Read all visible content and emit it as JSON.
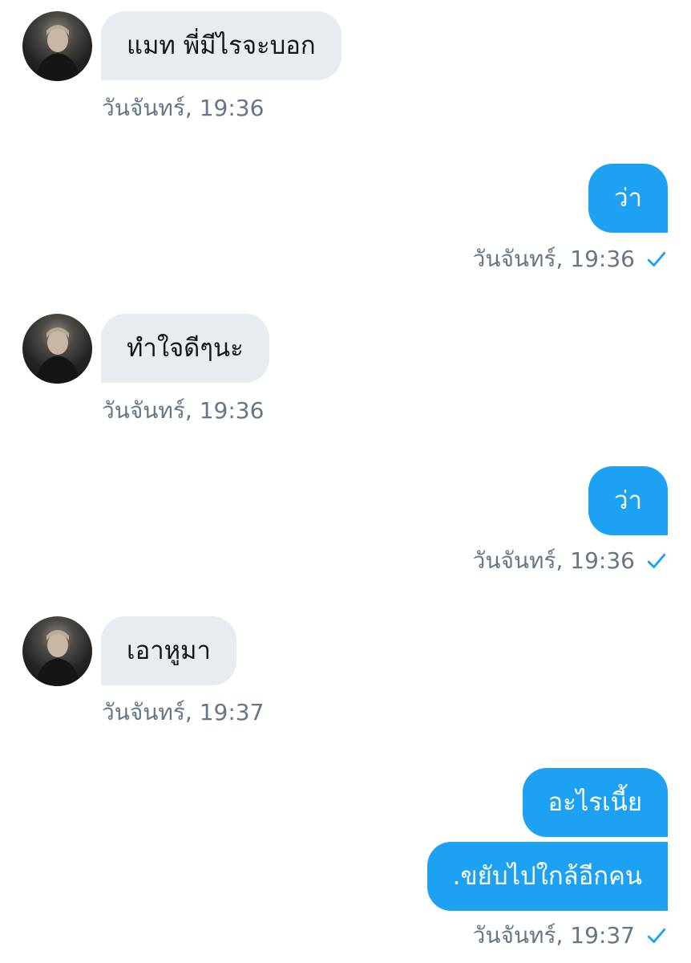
{
  "colors": {
    "incoming_bubble": "#e6ecf0",
    "outgoing_bubble": "#1da1f2",
    "timestamp": "#657786",
    "read_check": "#1da1f2"
  },
  "messages": [
    {
      "direction": "incoming",
      "text": "แมท พี่มีไรจะบอก",
      "time": "วันจันทร์, 19:36"
    },
    {
      "direction": "outgoing",
      "text": "ว่า",
      "time": "วันจันทร์, 19:36",
      "status_icon": "check-icon"
    },
    {
      "direction": "incoming",
      "text": "ทำใจดีๆนะ",
      "time": "วันจันทร์, 19:36"
    },
    {
      "direction": "outgoing",
      "text": "ว่า",
      "time": "วันจันทร์, 19:36",
      "status_icon": "check-icon"
    },
    {
      "direction": "incoming",
      "text": "เอาหูมา",
      "time": "วันจันทร์, 19:37"
    },
    {
      "direction": "outgoing",
      "text": "อะไรเนี้ย"
    },
    {
      "direction": "outgoing",
      "text": ".ขยับไปใกล้อีกคน",
      "time": "วันจันทร์, 19:37",
      "status_icon": "check-icon"
    }
  ]
}
